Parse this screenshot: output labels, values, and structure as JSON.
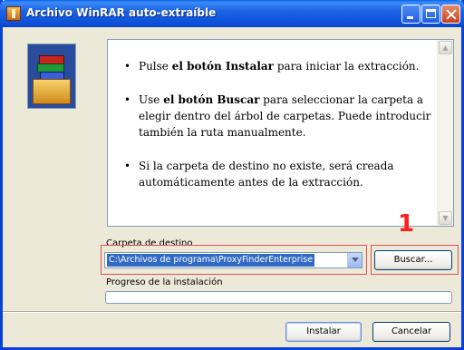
{
  "window": {
    "title": "Archivo WinRAR auto-extraíble"
  },
  "instructions": [
    {
      "pre": "Pulse ",
      "bold": "el botón Instalar",
      "post": " para iniciar la extracción."
    },
    {
      "pre": "Use ",
      "bold": "el botón Buscar",
      "post": " para seleccionar la carpeta a elegir dentro del árbol de carpetas. Puede introducir también la ruta manualmente."
    },
    {
      "pre": "Si la carpeta de destino no existe, será creada automáticamente antes de la extracción.",
      "bold": "",
      "post": ""
    }
  ],
  "destination": {
    "label": "Carpeta de destino",
    "value": "C:\\Archivos de programa\\ProxyFinderEnterprise"
  },
  "browse_label": "Buscar...",
  "annotation_number": "1",
  "progress": {
    "label": "Progreso de la instalación",
    "value": 0
  },
  "buttons": {
    "install": "Instalar",
    "cancel": "Cancelar"
  },
  "icons": {
    "app": "winrar-icon",
    "logo": "winrar-archive-box-icon"
  },
  "colors": {
    "titlebar": "#0a4fd6",
    "highlight": "#e05050",
    "selection": "#316ac5"
  }
}
